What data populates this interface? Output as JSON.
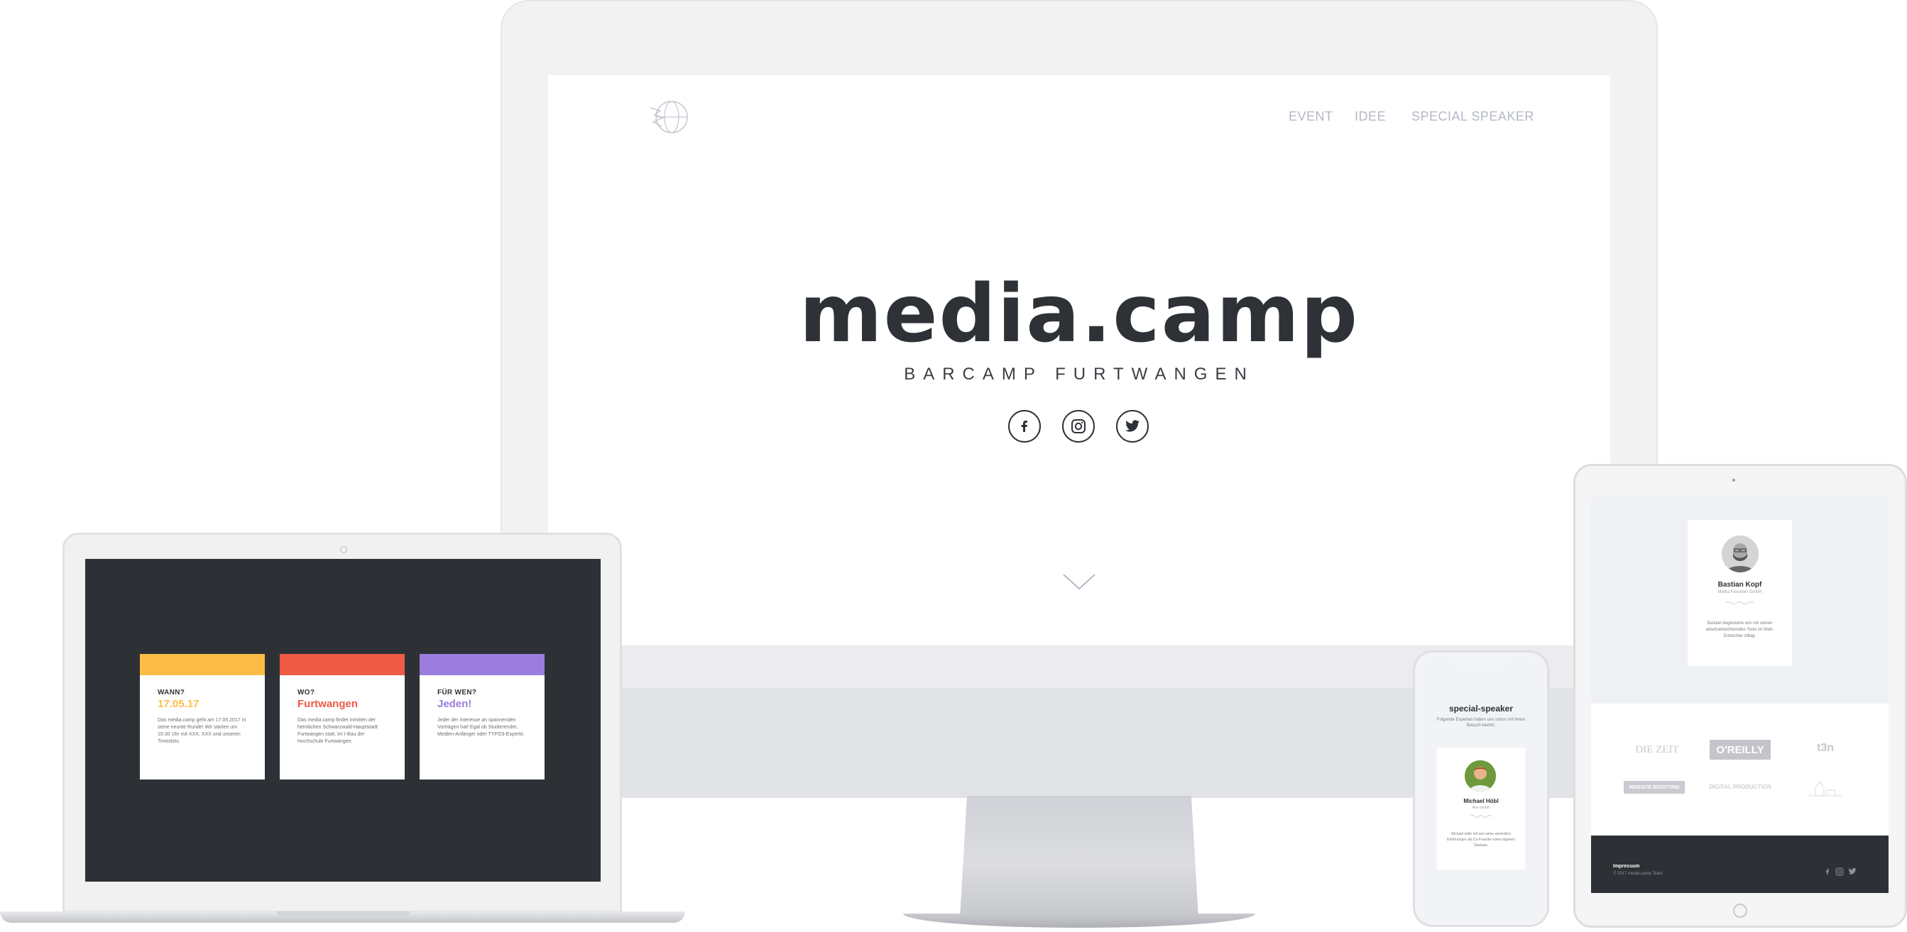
{
  "monitor": {
    "nav": {
      "event": "EVENT",
      "idea": "IDEE",
      "special_speaker": "SPECIAL SPEAKER"
    },
    "hero": {
      "title": "media.camp",
      "subtitle": "BARCAMP FURTWANGEN"
    },
    "social_icons": [
      "facebook-icon",
      "instagram-icon",
      "twitter-icon"
    ]
  },
  "laptop": {
    "cards": [
      {
        "label": "WANN?",
        "value": "17.05.17",
        "color": "#fbbd46",
        "text": "Das media.camp geht am 17.05.2017 in seine neunte Runde! Wir starten um 15:30 Uhr mit XXX, XXX und unseren Timeslots."
      },
      {
        "label": "WO?",
        "value": "Furtwangen",
        "color": "#ee5a44",
        "text": "Das media.camp findet inmitten der heimlichen Schwarzwald-Hauptstadt Furtwangen statt. Im I-Bau der Hochschule Furtwangen."
      },
      {
        "label": "FÜR WEN?",
        "value": "Jeden!",
        "color": "#9a7ddc",
        "text": "Jeder der Interesse an spannenden Vorträgen hat! Egal ob Studierender, Medien-Anfänger oder TYPO3-Experte."
      }
    ]
  },
  "phone": {
    "title": "special-speaker",
    "intro": "Folgende Experten haben uns schon mit ihrem Besuch beehrt.",
    "speaker": {
      "name": "Michael Höbl",
      "role": "Rex GmbH",
      "bio": "Michael teilte mit uns seine wertvollen Erfahrungen als Co-Founder eines eigenen Startups."
    }
  },
  "tablet": {
    "speaker": {
      "name": "Bastian Kopf",
      "role": "Media Favoriten GmbH",
      "bio": "Bastian begeisterte uns mit seinen arbeitserleichternden Tools im Web-Entwickler Alltag."
    },
    "partner_logos": [
      "DIE ZEIT",
      "O'REILLY",
      "t3n",
      "WEBSITE BOOSTING",
      "DIGITAL PRODUCTION",
      "LOGO"
    ],
    "footer": {
      "imprint": "Impressum",
      "copyright": "© 2017 media.camp Team"
    }
  },
  "colors": {
    "dark": "#2d3136",
    "yellow": "#fbbd46",
    "red": "#ee5a44",
    "purple": "#9a7ddc"
  }
}
